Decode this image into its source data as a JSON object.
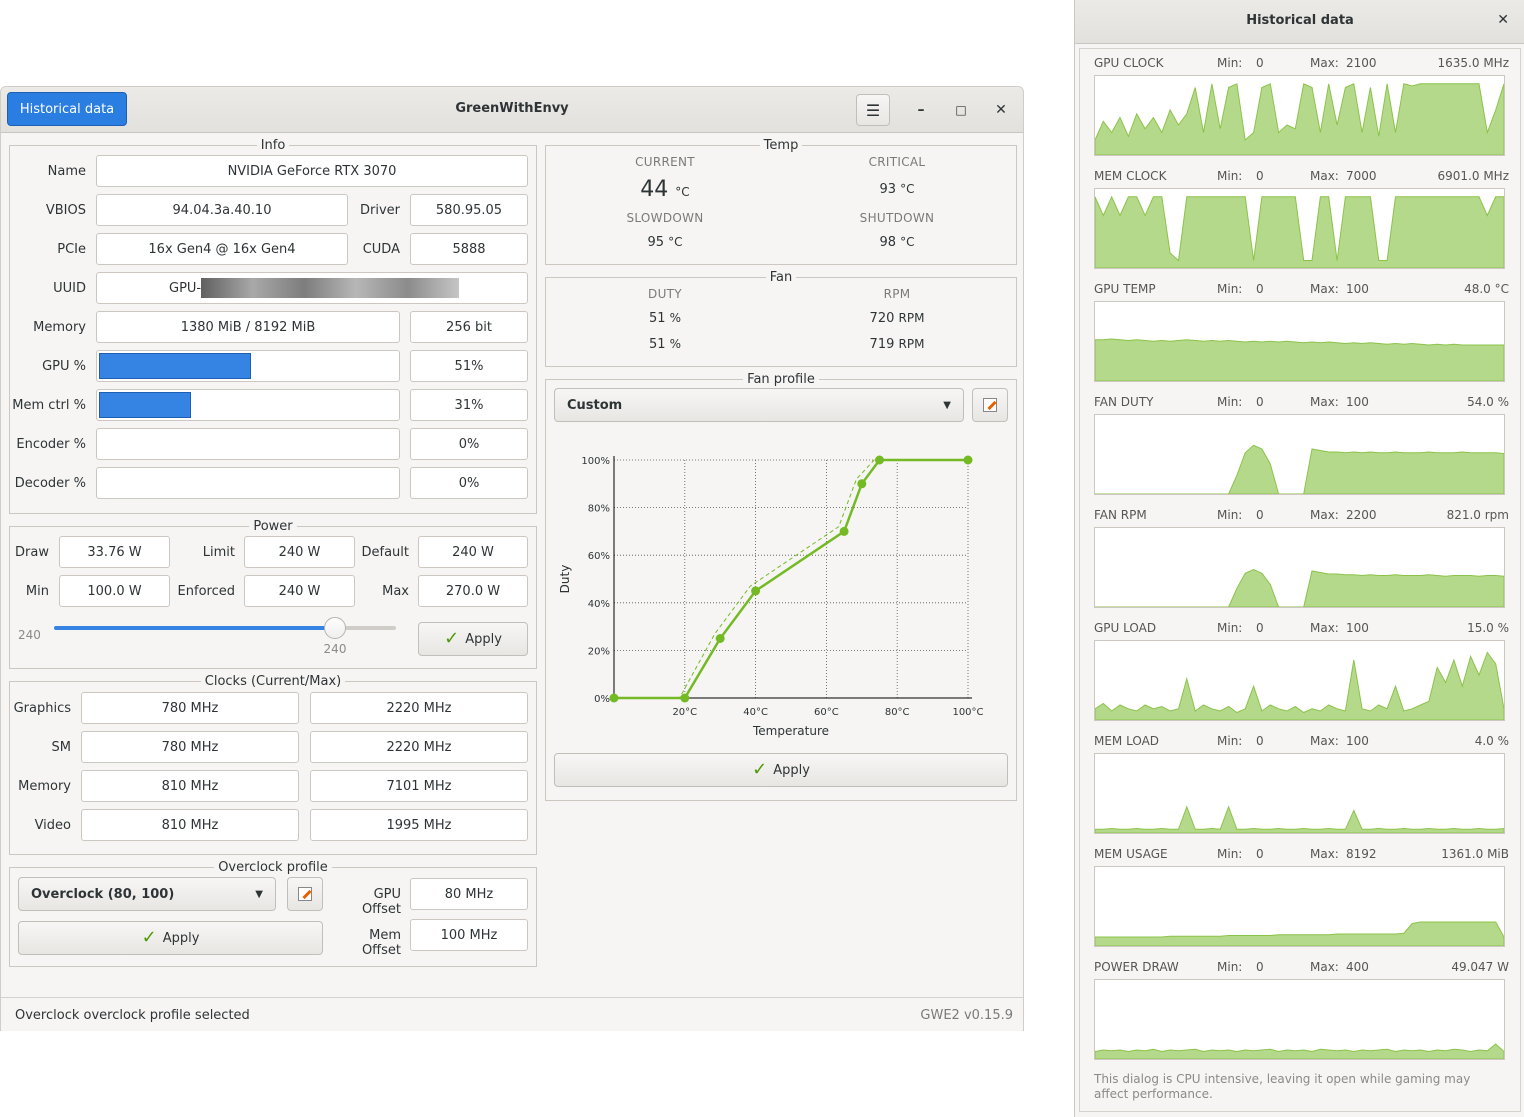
{
  "window": {
    "title": "GreenWithEnvy",
    "historical_button": "Historical data",
    "menu_icon": "hamburger-icon",
    "minimize": "–",
    "maximize": "□",
    "close": "✕"
  },
  "info": {
    "legend": "Info",
    "name_label": "Name",
    "name": "NVIDIA GeForce RTX 3070",
    "vbios_label": "VBIOS",
    "vbios": "94.04.3a.40.10",
    "driver_label": "Driver",
    "driver": "580.95.05",
    "pcie_label": "PCIe",
    "pcie": "16x Gen4 @ 16x Gen4",
    "cuda_label": "CUDA",
    "cuda": "5888",
    "uuid_label": "UUID",
    "uuid": "GPU-",
    "memory_label": "Memory",
    "memory": "1380 MiB / 8192 MiB",
    "bus": "256 bit",
    "gpu_label": "GPU %",
    "gpu_pct": "51%",
    "gpu_fill": 0.51,
    "memctrl_label": "Mem ctrl %",
    "memctrl_pct": "31%",
    "memctrl_fill": 0.31,
    "encoder_label": "Encoder %",
    "encoder_pct": "0%",
    "encoder_fill": 0,
    "decoder_label": "Decoder %",
    "decoder_pct": "0%",
    "decoder_fill": 0
  },
  "power": {
    "legend": "Power",
    "draw_label": "Draw",
    "draw": "33.76 W",
    "limit_label": "Limit",
    "limit": "240 W",
    "default_label": "Default",
    "default": "240 W",
    "min_label": "Min",
    "min": "100.0 W",
    "enforced_label": "Enforced",
    "enforced": "240 W",
    "max_label": "Max",
    "max": "270.0 W",
    "slider_left_label": "240",
    "slider_value_label": "240",
    "slider_level": 0.823,
    "apply": "Apply"
  },
  "clocks": {
    "legend": "Clocks (Current/Max)",
    "rows": [
      {
        "label": "Graphics",
        "current": "780 MHz",
        "max": "2220 MHz"
      },
      {
        "label": "SM",
        "current": "780 MHz",
        "max": "2220 MHz"
      },
      {
        "label": "Memory",
        "current": "810 MHz",
        "max": "7101 MHz"
      },
      {
        "label": "Video",
        "current": "810 MHz",
        "max": "1995 MHz"
      }
    ]
  },
  "overclock": {
    "legend": "Overclock profile",
    "profile": "Overclock (80, 100)",
    "gpu_offset_label": "GPU Offset",
    "gpu_offset": "80 MHz",
    "mem_offset_label": "Mem Offset",
    "mem_offset": "100 MHz",
    "apply": "Apply"
  },
  "temp": {
    "legend": "Temp",
    "current_label": "CURRENT",
    "current": "44",
    "current_unit": "°C",
    "critical_label": "CRITICAL",
    "critical": "93",
    "critical_unit": "°C",
    "slowdown_label": "SLOWDOWN",
    "slowdown": "95",
    "slowdown_unit": "°C",
    "shutdown_label": "SHUTDOWN",
    "shutdown": "98",
    "shutdown_unit": "°C"
  },
  "fan": {
    "legend": "Fan",
    "duty_label": "DUTY",
    "rpm_label": "RPM",
    "duty1": "51",
    "duty2": "51",
    "duty_unit": "%",
    "rpm1": "720",
    "rpm2": "719",
    "rpm_unit": "RPM"
  },
  "fan_profile": {
    "legend": "Fan profile",
    "profile": "Custom",
    "apply": "Apply"
  },
  "chart_data": {
    "type": "line",
    "xlabel": "Temperature",
    "ylabel": "Duty",
    "xlim": [
      0,
      100
    ],
    "ylim": [
      0,
      100
    ],
    "x_ticks": [
      "20°C",
      "40°C",
      "60°C",
      "80°C",
      "100°C"
    ],
    "y_ticks": [
      "0%",
      "20%",
      "40%",
      "60%",
      "80%",
      "100%"
    ],
    "grid": true,
    "series": [
      {
        "values": [
          [
            0,
            0
          ],
          [
            20,
            0
          ],
          [
            30,
            25
          ],
          [
            40,
            45
          ],
          [
            65,
            70
          ],
          [
            70,
            90
          ],
          [
            75,
            100
          ],
          [
            100,
            100
          ]
        ]
      }
    ],
    "color": "#73ba25"
  },
  "status": {
    "message": "Overclock overclock profile selected",
    "version": "GWE2 v0.15.9"
  },
  "historical": {
    "title": "Historical data",
    "close": "✕",
    "min_label": "Min:",
    "max_label": "Max:",
    "graphs": [
      {
        "name": "GPU CLOCK",
        "min": "0",
        "max": "2100",
        "current": "1635.0 MHz"
      },
      {
        "name": "MEM CLOCK",
        "min": "0",
        "max": "7000",
        "current": "6901.0 MHz"
      },
      {
        "name": "GPU TEMP",
        "min": "0",
        "max": "100",
        "current": "48.0 °C"
      },
      {
        "name": "FAN DUTY",
        "min": "0",
        "max": "100",
        "current": "54.0 %"
      },
      {
        "name": "FAN RPM",
        "min": "0",
        "max": "2200",
        "current": "821.0 rpm"
      },
      {
        "name": "GPU LOAD",
        "min": "0",
        "max": "100",
        "current": "15.0 %"
      },
      {
        "name": "MEM LOAD",
        "min": "0",
        "max": "100",
        "current": "4.0 %"
      },
      {
        "name": "MEM USAGE",
        "min": "0",
        "max": "8192",
        "current": "1361.0 MiB"
      },
      {
        "name": "POWER DRAW",
        "min": "0",
        "max": "400",
        "current": "49.047 W"
      }
    ],
    "note": "This dialog is CPU intensive, leaving it open while gaming may affect performance.",
    "fill_color": "#b5d98a",
    "line_color": "#8bc34a"
  }
}
